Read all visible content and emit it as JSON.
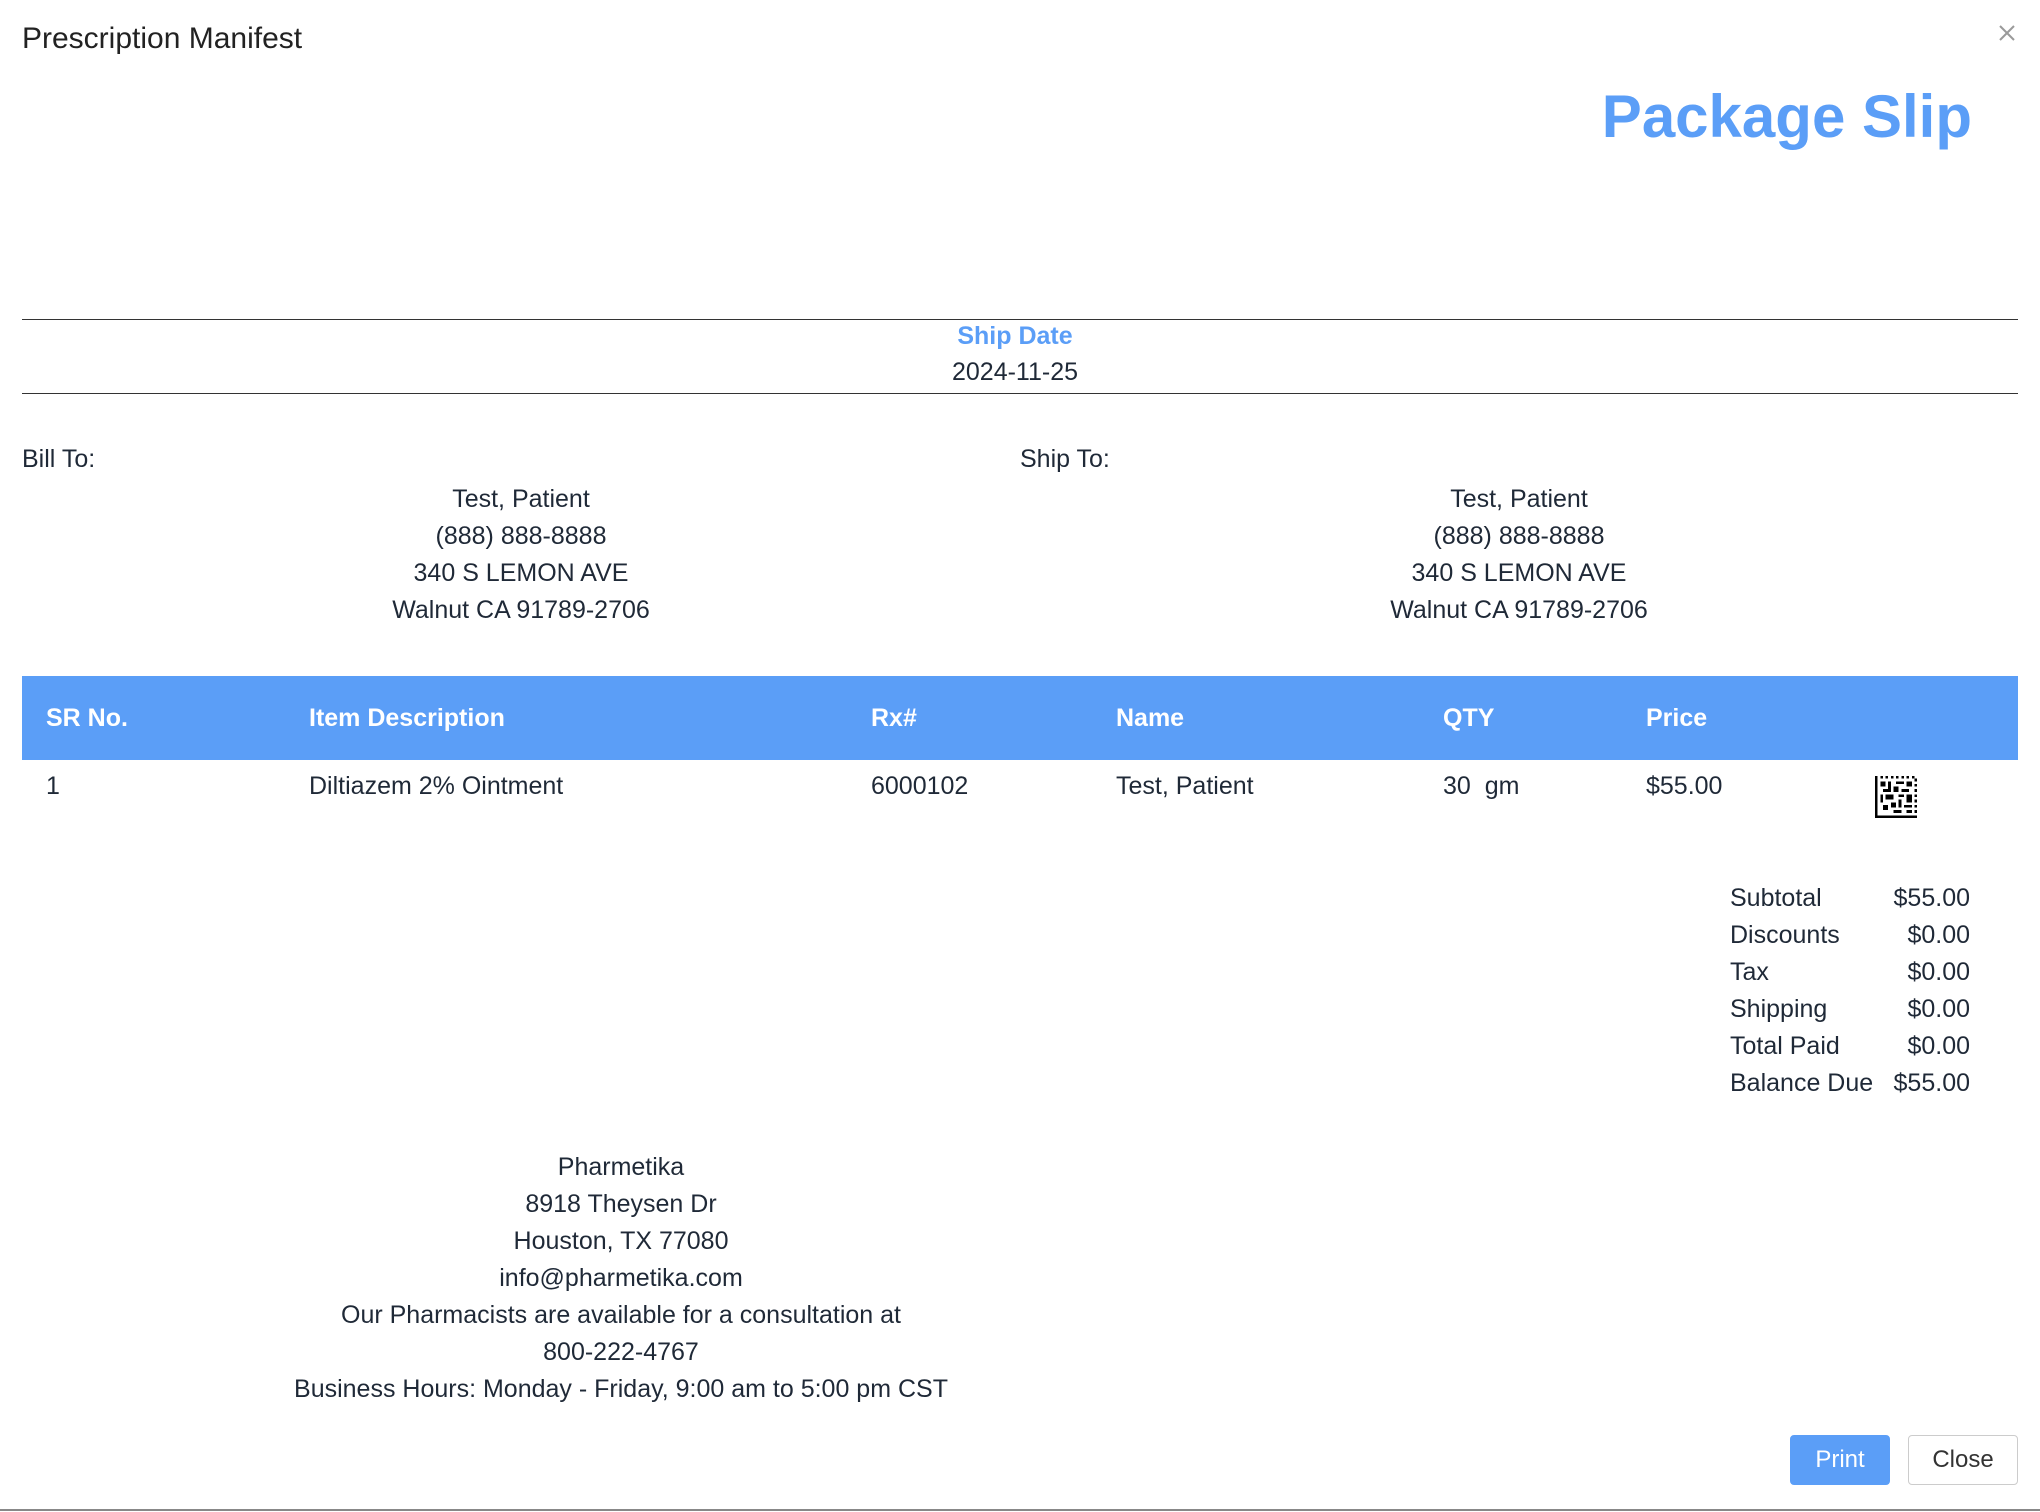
{
  "dialog": {
    "title": "Prescription Manifest",
    "close_icon": "close-icon"
  },
  "slip": {
    "title": "Package Slip",
    "ship_date_label": "Ship Date",
    "ship_date": "2024-11-25"
  },
  "bill_to": {
    "label": "Bill To:",
    "name": "Test, Patient",
    "phone": "(888) 888-8888",
    "street": "340 S LEMON AVE",
    "city": "Walnut CA 91789-2706"
  },
  "ship_to": {
    "label": "Ship To:",
    "name": "Test, Patient",
    "phone": "(888) 888-8888",
    "street": "340 S LEMON AVE",
    "city": "Walnut CA 91789-2706"
  },
  "table": {
    "headers": [
      "SR No.",
      "Item Description",
      "Rx#",
      "Name",
      "QTY",
      "Price"
    ],
    "rows": [
      [
        "1",
        "Diltiazem 2% Ointment",
        "6000102",
        "Test, Patient",
        "30  gm",
        "$55.00"
      ]
    ],
    "row_icon": "datamatrix-barcode-icon"
  },
  "totals": [
    {
      "label": "Subtotal",
      "value": "$55.00"
    },
    {
      "label": "Discounts",
      "value": "$0.00"
    },
    {
      "label": "Tax",
      "value": "$0.00"
    },
    {
      "label": "Shipping",
      "value": "$0.00"
    },
    {
      "label": "Total Paid",
      "value": "$0.00"
    },
    {
      "label": "Balance Due",
      "value": "$55.00"
    }
  ],
  "footer": {
    "company": "Pharmetika",
    "street": "8918 Theysen Dr",
    "city": "Houston, TX 77080",
    "email": "info@pharmetika.com",
    "consult_line": "Our Pharmacists are available for a consultation at",
    "phone": "800-222-4767",
    "hours": "Business Hours: Monday - Friday, 9:00 am to 5:00 pm CST"
  },
  "buttons": {
    "print": "Print",
    "close": "Close"
  },
  "colors": {
    "accent": "#5b9ef7",
    "text": "#1f2937"
  }
}
